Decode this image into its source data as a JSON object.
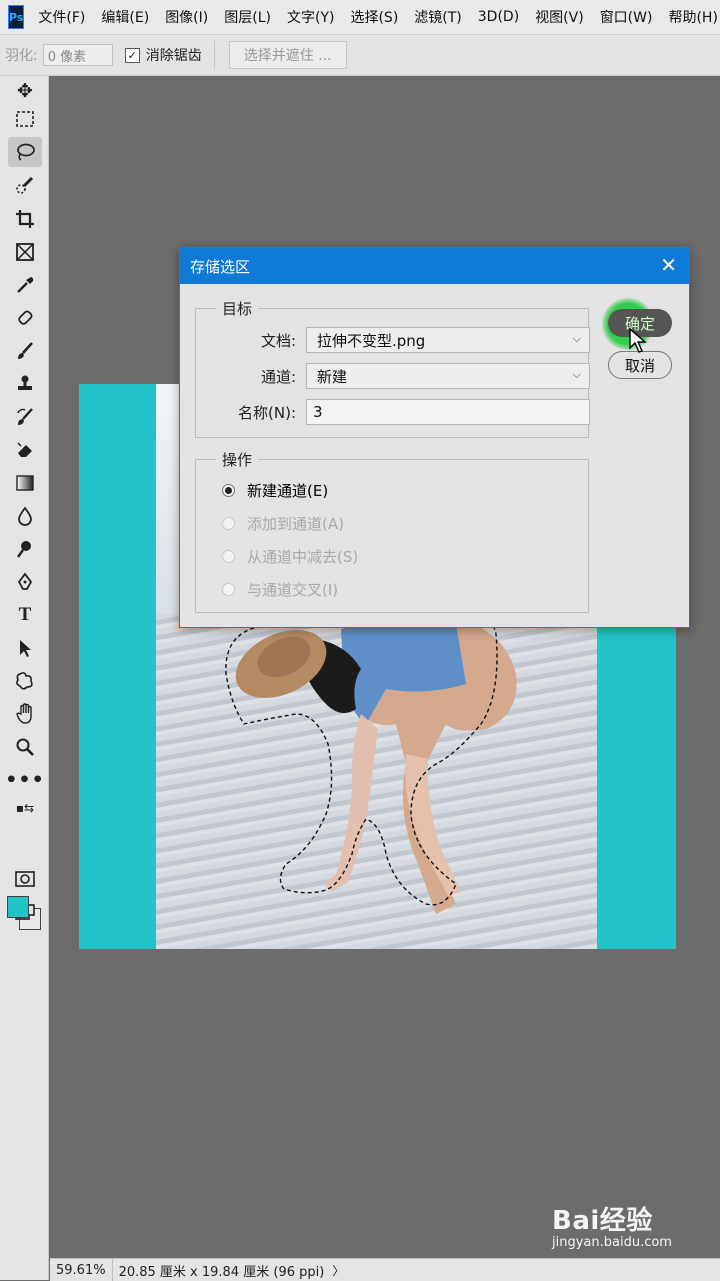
{
  "app": {
    "logo": "Ps"
  },
  "menu": [
    "文件(F)",
    "编辑(E)",
    "图像(I)",
    "图层(L)",
    "文字(Y)",
    "选择(S)",
    "滤镜(T)",
    "3D(D)",
    "视图(V)",
    "窗口(W)",
    "帮助(H)"
  ],
  "options": {
    "feather_label": "羽化:",
    "feather_value": "0 像素",
    "antialias_label": "消除锯齿",
    "antialias_checked": true,
    "select_mask_label": "选择并遮住 ..."
  },
  "tools": [
    "move-icon",
    "marquee-icon",
    "lasso-icon",
    "quick-select-icon",
    "crop-icon",
    "frame-icon",
    "eyedropper-icon",
    "healing-icon",
    "brush-icon",
    "stamp-icon",
    "history-brush-icon",
    "eraser-icon",
    "gradient-icon",
    "blur-icon",
    "dodge-icon",
    "pen-icon",
    "type-icon",
    "path-select-icon",
    "shape-icon",
    "hand-icon",
    "zoom-icon",
    "more-icon"
  ],
  "colors": {
    "foreground": "#22c3c9",
    "background": "#e8e8e8",
    "accent": "#0f7ad6",
    "canvas_fill": "#22c3c9"
  },
  "dialog": {
    "title": "存储选区",
    "target_legend": "目标",
    "document_label": "文档:",
    "document_value": "拉伸不变型.png",
    "channel_label": "通道:",
    "channel_value": "新建",
    "name_label": "名称(N):",
    "name_value": "3",
    "operation_legend": "操作",
    "operations": [
      {
        "label": "新建通道(E)",
        "selected": true,
        "enabled": true
      },
      {
        "label": "添加到通道(A)",
        "selected": false,
        "enabled": false
      },
      {
        "label": "从通道中减去(S)",
        "selected": false,
        "enabled": false
      },
      {
        "label": "与通道交叉(I)",
        "selected": false,
        "enabled": false
      }
    ],
    "ok_label": "确定",
    "cancel_label": "取消"
  },
  "status": {
    "zoom": "59.61%",
    "doc_info": "20.85 厘米 x 19.84 厘米 (96 ppi)",
    "arrow": "〉"
  },
  "watermark": {
    "logo": "Bai经验",
    "url": "jingyan.baidu.com"
  }
}
